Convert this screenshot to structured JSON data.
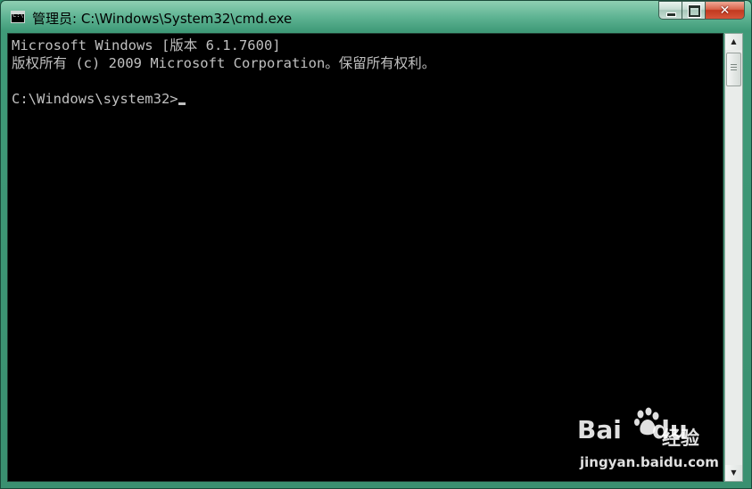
{
  "window": {
    "title": "管理员: C:\\Windows\\System32\\cmd.exe",
    "icon": "cmd-icon",
    "icon_text": "C:\\",
    "controls": {
      "minimize": "minimize-icon",
      "maximize": "maximize-icon",
      "close": "close-icon",
      "close_glyph": "✕"
    }
  },
  "console": {
    "lines": [
      "Microsoft Windows [版本 6.1.7600]",
      "版权所有 (c) 2009 Microsoft Corporation。保留所有权利。",
      "",
      "C:\\Windows\\system32>"
    ],
    "text_color": "#c0c0c0",
    "background": "#000000"
  },
  "scrollbar": {
    "up": "▲",
    "down": "▼"
  },
  "watermark": {
    "logo": "Bai",
    "logo_suffix": "du",
    "product": "经验",
    "url": "jingyan.baidu.com"
  }
}
